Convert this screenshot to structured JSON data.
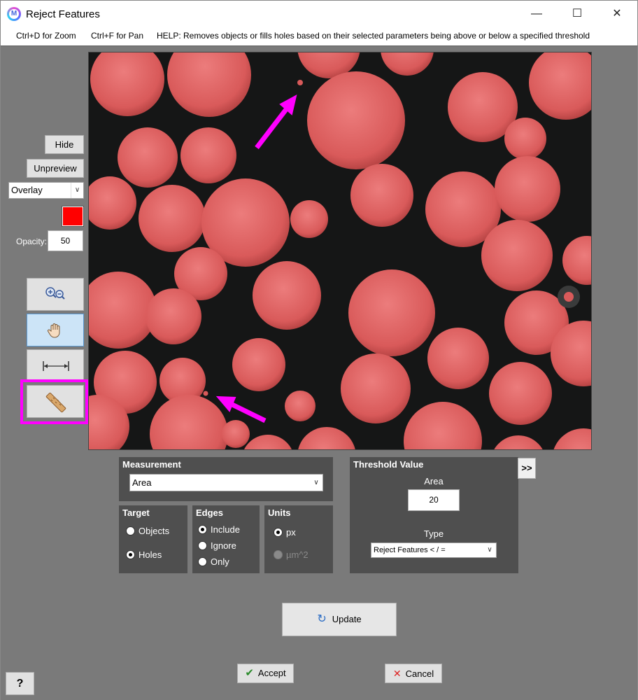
{
  "window": {
    "title": "Reject Features",
    "app_icon_letter": "M",
    "controls": {
      "minimize": "—",
      "maximize": "☐",
      "close": "✕"
    }
  },
  "helpbar": {
    "zoom_hint": "Ctrl+D for Zoom",
    "pan_hint": "Ctrl+F for Pan",
    "help_text": "HELP:  Removes objects or fills holes based on their selected parameters being above or below a specified threshold"
  },
  "left_panel": {
    "hide_label": "Hide",
    "unpreview_label": "Unpreview",
    "overlay_mode": "Overlay",
    "overlay_color": "#ff0000",
    "opacity_label": "Opacity:",
    "opacity_value": "50",
    "tools": [
      "zoom-tool",
      "pan-tool",
      "measure-tool",
      "ruler-tool"
    ],
    "highlight_color": "#ff00ff"
  },
  "measurement": {
    "title": "Measurement",
    "selected": "Area"
  },
  "target": {
    "title": "Target",
    "options": [
      "Objects",
      "Holes"
    ],
    "selected": "Holes"
  },
  "edges": {
    "title": "Edges",
    "options": [
      "Include",
      "Ignore",
      "Only"
    ],
    "selected": "Include"
  },
  "units": {
    "title": "Units",
    "options": [
      "px",
      "µm^2"
    ],
    "selected": "px"
  },
  "threshold": {
    "title": "Threshold Value",
    "measure_label": "Area",
    "value": "20",
    "type_label": "Type",
    "type_selected": "Reject Features < / ="
  },
  "expand_label": ">>",
  "buttons": {
    "update": "Update",
    "accept": "Accept",
    "cancel": "Cancel",
    "help": "?"
  }
}
